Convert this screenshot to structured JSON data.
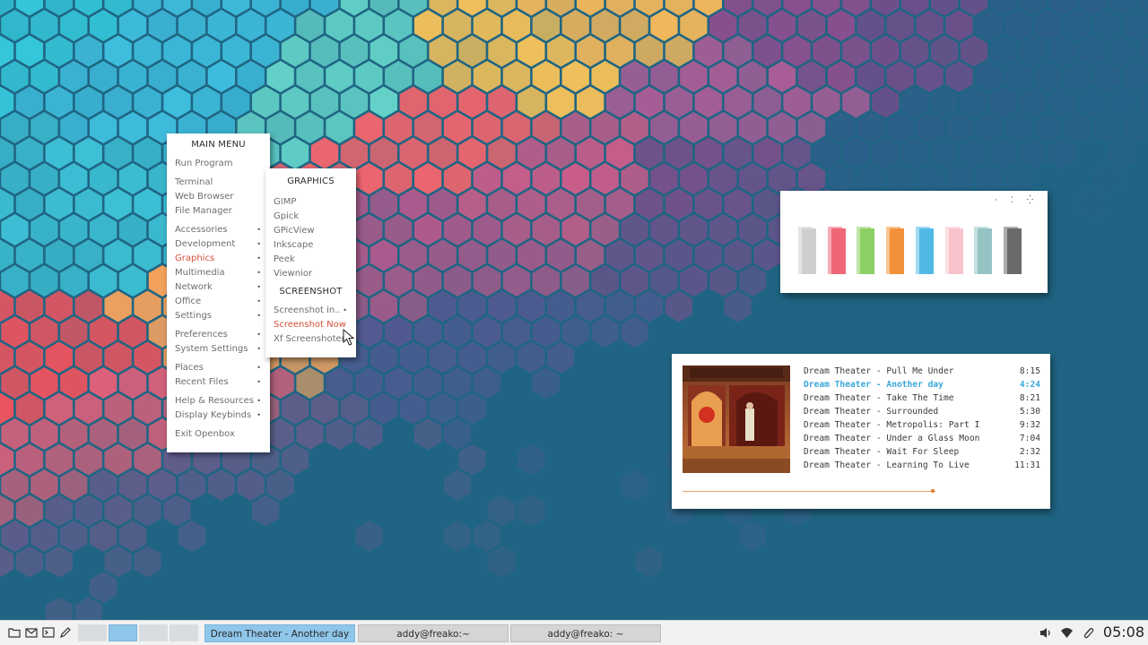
{
  "main_menu": {
    "title": "MAIN MENU",
    "items": [
      {
        "label": "Run Program",
        "submenu": false
      },
      {
        "sep": true
      },
      {
        "label": "Terminal",
        "submenu": false
      },
      {
        "label": "Web Browser",
        "submenu": false
      },
      {
        "label": "File Manager",
        "submenu": false
      },
      {
        "sep": true
      },
      {
        "label": "Accessories",
        "submenu": true
      },
      {
        "label": "Development",
        "submenu": true
      },
      {
        "label": "Graphics",
        "submenu": true,
        "active": true
      },
      {
        "label": "Multimedia",
        "submenu": true
      },
      {
        "label": "Network",
        "submenu": true
      },
      {
        "label": "Office",
        "submenu": true
      },
      {
        "label": "Settings",
        "submenu": true
      },
      {
        "sep": true
      },
      {
        "label": "Preferences",
        "submenu": true
      },
      {
        "label": "System Settings",
        "submenu": true
      },
      {
        "sep": true
      },
      {
        "label": "Places",
        "submenu": true
      },
      {
        "label": "Recent Files",
        "submenu": true
      },
      {
        "sep": true
      },
      {
        "label": "Help & Resources",
        "submenu": true
      },
      {
        "label": "Display Keybinds",
        "submenu": true
      },
      {
        "sep": true
      },
      {
        "label": "Exit Openbox",
        "submenu": false
      }
    ]
  },
  "graphics_menu": {
    "title": "GRAPHICS",
    "items": [
      "GIMP",
      "Gpick",
      "GPicView",
      "Inkscape",
      "Peek",
      "Viewnior"
    ],
    "screenshot_title": "SCREENSHOT",
    "screenshot_items": [
      {
        "label": "Screenshot in..",
        "submenu": true
      },
      {
        "label": "Screenshot Now",
        "submenu": false,
        "active": true
      },
      {
        "label": "Xf Screenshoter",
        "submenu": false
      }
    ]
  },
  "palette": {
    "colors": [
      "#cfcfcf",
      "#ef6677",
      "#8ccf63",
      "#f2913a",
      "#52b9e6",
      "#f8c3cb",
      "#95c3c4",
      "#6a6a6a"
    ]
  },
  "music": {
    "current_index": 1,
    "progress": 0.99,
    "tracks": [
      {
        "title": "Dream Theater - Pull Me Under",
        "duration": "8:15"
      },
      {
        "title": "Dream Theater - Another day",
        "duration": "4:24"
      },
      {
        "title": "Dream Theater - Take The Time",
        "duration": "8:21"
      },
      {
        "title": "Dream Theater - Surrounded",
        "duration": "5:30"
      },
      {
        "title": "Dream Theater - Metropolis: Part I",
        "duration": "9:32"
      },
      {
        "title": "Dream Theater - Under a Glass Moon",
        "duration": "7:04"
      },
      {
        "title": "Dream Theater - Wait For Sleep",
        "duration": "2:32"
      },
      {
        "title": "Dream Theater - Learning To Live",
        "duration": "11:31"
      }
    ]
  },
  "panel": {
    "launchers": [
      "folder-icon",
      "mail-icon",
      "terminal-icon",
      "pen-icon"
    ],
    "desktops": 4,
    "active_desktop": 1,
    "tasks": [
      {
        "label": "Dream Theater - Another day",
        "active": true
      },
      {
        "label": "addy@freako:~",
        "active": false
      },
      {
        "label": "addy@freako: ~",
        "active": false
      }
    ],
    "tray": [
      "volume-icon",
      "wifi-icon",
      "clip-icon"
    ],
    "clock": "05:08"
  }
}
